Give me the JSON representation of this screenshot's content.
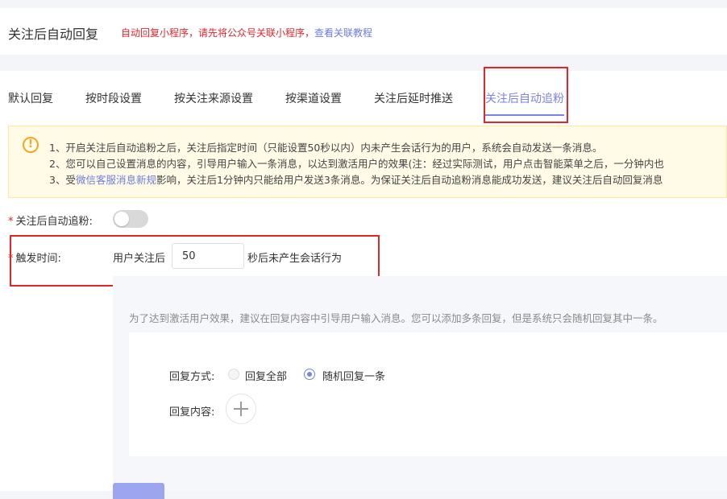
{
  "header": {
    "title": "关注后自动回复",
    "notice": "自动回复小程序，请先将公众号关联小程序，",
    "notice_link": "查看关联教程"
  },
  "tabs": [
    {
      "label": "默认回复",
      "active": false
    },
    {
      "label": "按时段设置",
      "active": false
    },
    {
      "label": "按关注来源设置",
      "active": false
    },
    {
      "label": "按渠道设置",
      "active": false
    },
    {
      "label": "关注后延时推送",
      "active": false
    },
    {
      "label": "关注后自动追粉",
      "active": true
    }
  ],
  "alert": {
    "icon": "warning-icon",
    "line1": "1、开启关注后自动追粉之后，关注后指定时间（只能设置50秒以内）内未产生会话行为的用户，系统会自动发送一条消息。",
    "line2": "2、您可以自己设置消息的内容，引导用户输入一条消息，以达到激活用户的效果(注：经过实际测试，用户点击智能菜单之后，一分钟内也",
    "line3_prefix": "3、受",
    "line3_link": "微信客服消息新规",
    "line3_suffix": "影响，关注后1分钟内只能给用户发送3条消息。为保证关注后自动追粉消息能成功发送，建议关注后自动回复消息"
  },
  "form": {
    "auto_follow_label": "关注后自动追粉:",
    "auto_follow_enabled": false,
    "trigger_label": "触发时间:",
    "trigger_prefix": "用户关注后",
    "trigger_value": "50",
    "trigger_suffix": "秒后未产生会话行为",
    "hint": "为了达到激活用户效果，建议在回复内容中引导用户输入消息。您可以添加多条回复，但是系统只会随机回复其中一条。",
    "reply_mode_label": "回复方式:",
    "reply_all_label": "回复全部",
    "reply_random_label": "随机回复一条",
    "reply_random_selected": true,
    "reply_content_label": "回复内容:"
  },
  "colors": {
    "accent": "#7b83e6",
    "highlight_box": "#e0252b",
    "warning": "#f5a623"
  }
}
